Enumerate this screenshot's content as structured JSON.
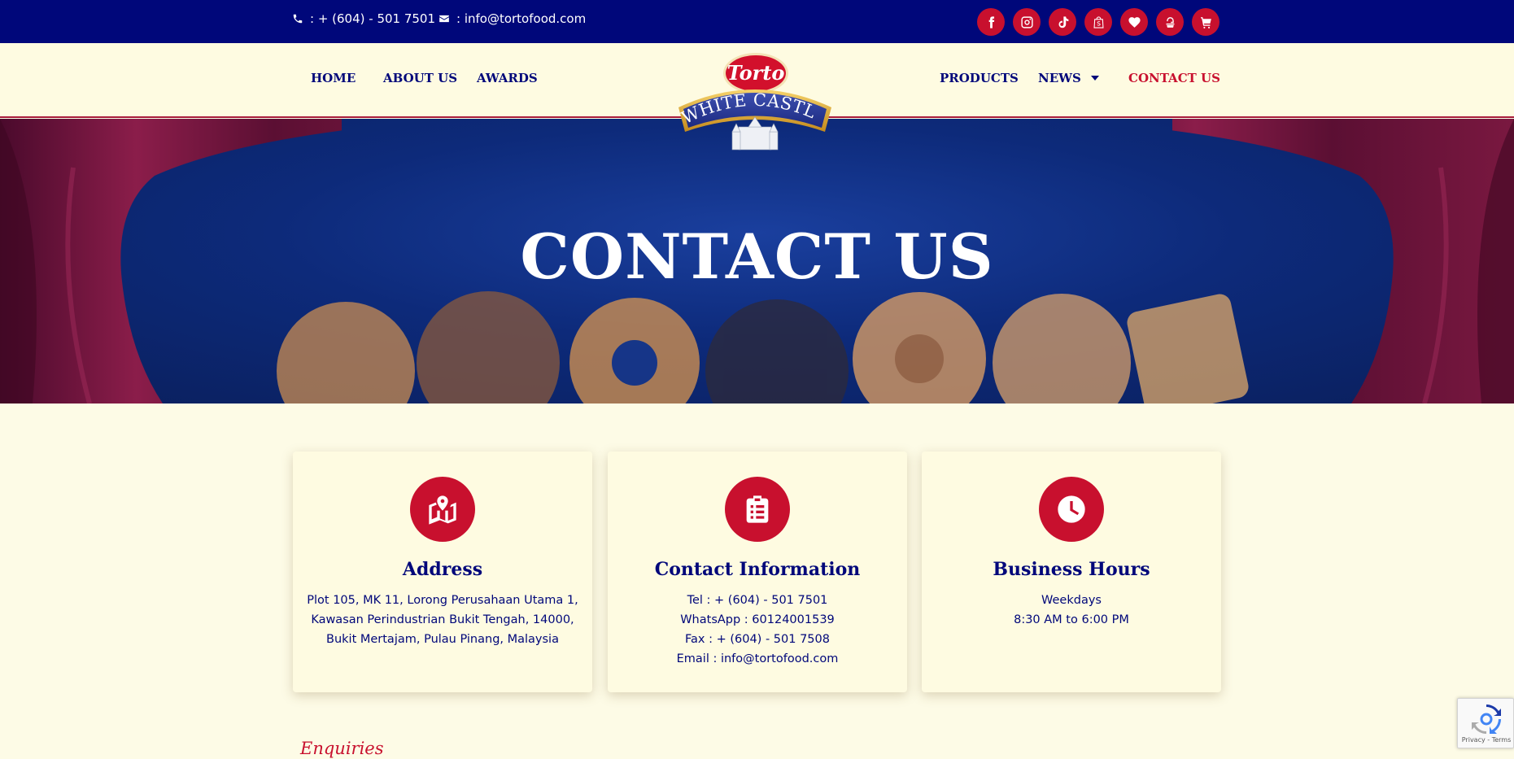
{
  "topbar": {
    "phone": ": + (604) - 501 7501",
    "email": ": info@tortofood.com",
    "socials": [
      "facebook-icon",
      "instagram-icon",
      "tiktok-icon",
      "shopee-icon",
      "lazada-icon",
      "store-icon",
      "cart-icon"
    ]
  },
  "nav": {
    "home": "HOME",
    "about": "ABOUT US",
    "awards": "AWARDS",
    "products": "PRODUCTS",
    "news": "NEWS",
    "contact": "CONTACT US"
  },
  "logo": {
    "brand": "Torto",
    "sub": "WHITE CASTLE"
  },
  "hero": {
    "title": "CONTACT US"
  },
  "cards": {
    "address": {
      "title": "Address",
      "lines": [
        "Plot 105, MK 11, Lorong Perusahaan Utama 1,",
        "Kawasan Perindustrian Bukit Tengah, 14000,",
        "Bukit Mertajam, Pulau Pinang, Malaysia"
      ]
    },
    "contact": {
      "title": "Contact Information",
      "lines": [
        "Tel : + (604) - 501 7501",
        "WhatsApp : 60124001539",
        "Fax : + (604) - 501 7508",
        "Email : info@tortofood.com"
      ]
    },
    "hours": {
      "title": "Business Hours",
      "lines": [
        "Weekdays",
        "8:30 AM to 6:00 PM"
      ]
    }
  },
  "enquiries": {
    "heading": "Enquiries"
  },
  "recaptcha": {
    "terms": "Privacy - Terms"
  },
  "colors": {
    "navy": "#00077a",
    "red": "#c8102e",
    "cream": "#fdfbe6"
  }
}
